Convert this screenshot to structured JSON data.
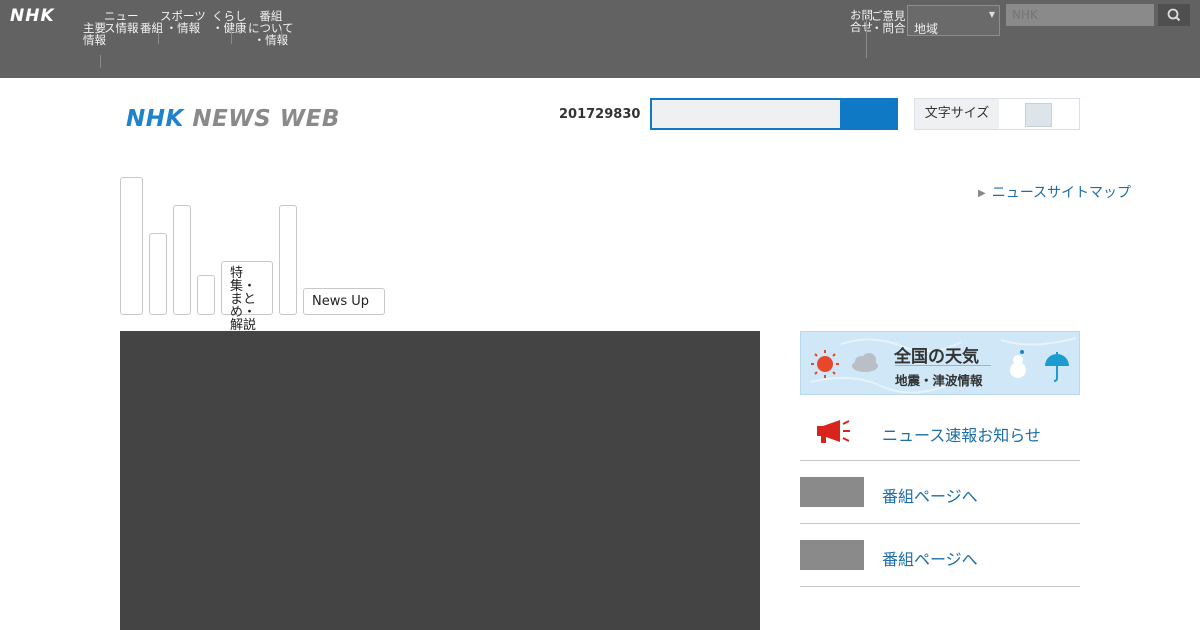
{
  "global_header": {
    "logo": "NHK",
    "nav": [
      "主要\n情報",
      "ニュー\nス情報",
      "番組",
      "スポーツ\n・情報",
      "くらし\n・健康",
      "番組\nについて\n・情報"
    ],
    "right_nav": [
      "お問\n合せ",
      "ご意見\n・問合"
    ],
    "select_value": "地域",
    "search_placeholder": "NHK"
  },
  "header": {
    "logo_nhk": "NHK",
    "logo_news_web": "NEWS WEB",
    "date": "201729830",
    "toggle_label": "文字サイズ"
  },
  "tabs": {
    "long_label": "特集・まとめ・解説",
    "news_up": "News Up"
  },
  "sitemap_link": "ニュースサイトマップ",
  "weather": {
    "title": "全国の天気",
    "subtitle": "地震・津波情報"
  },
  "side_links": [
    {
      "label": "ニュース速報お知らせ",
      "icon": "megaphone-icon"
    },
    {
      "label": "番組ページへ"
    },
    {
      "label": "番組ページへ"
    }
  ],
  "colors": {
    "accent": "#0f79c6",
    "link": "#1c6ea8",
    "header_bg": "#626262",
    "video_bg": "#444444"
  }
}
